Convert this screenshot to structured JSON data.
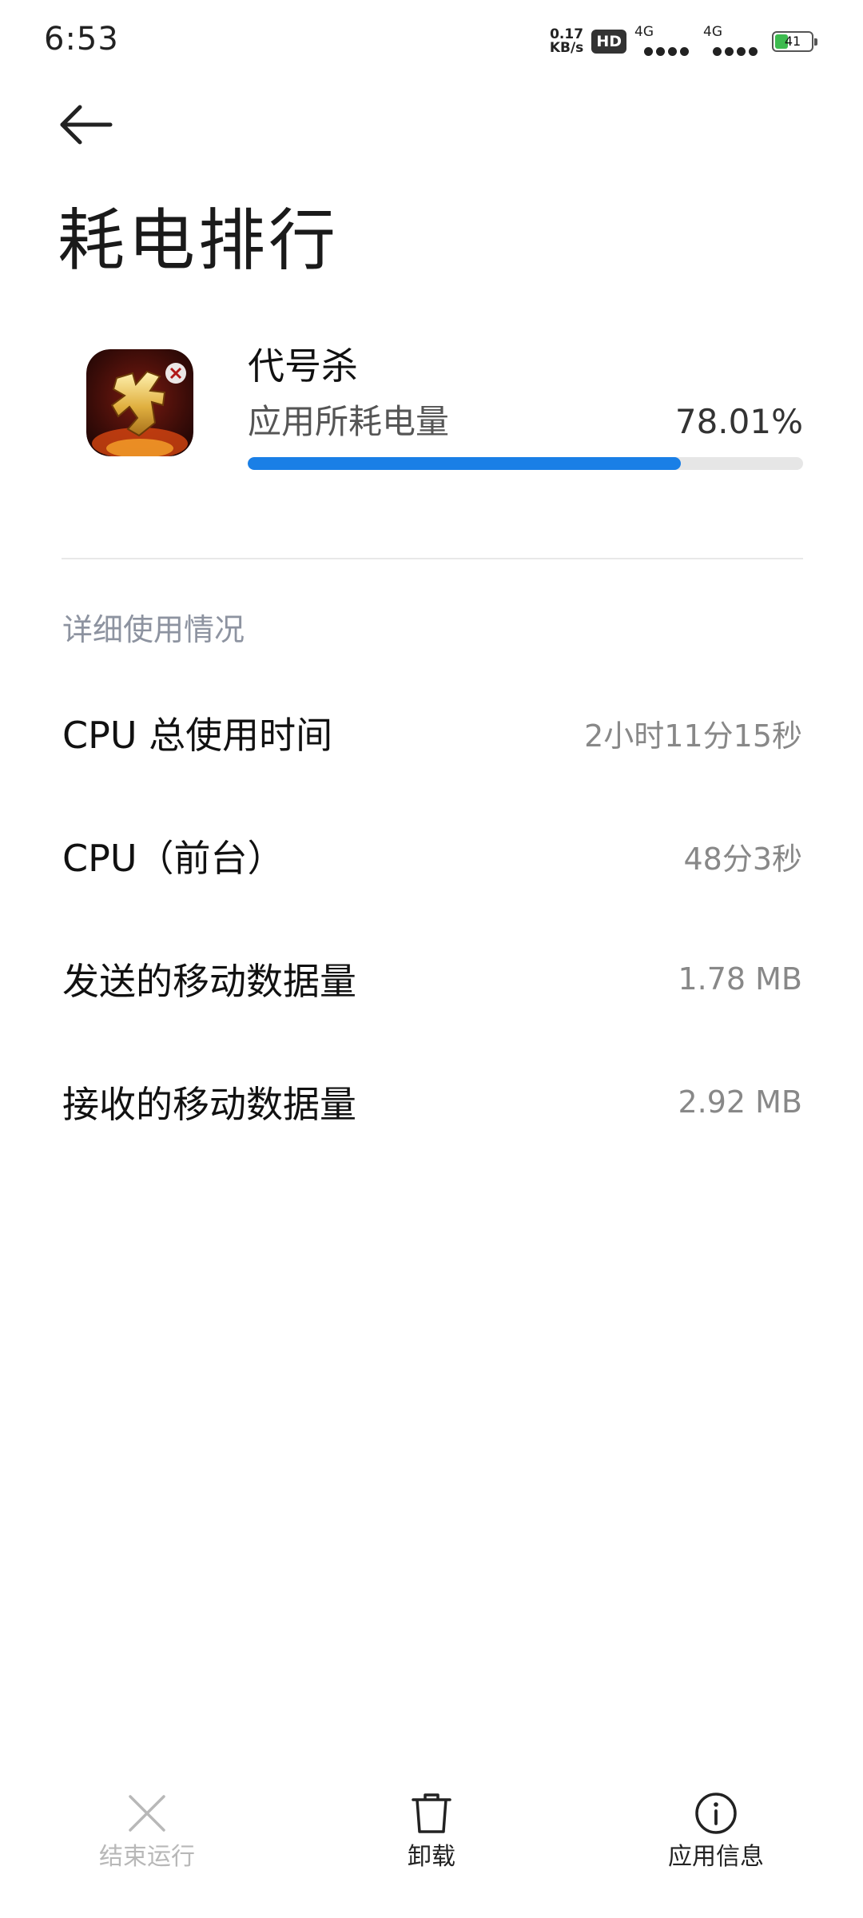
{
  "status_bar": {
    "time": "6:53",
    "net_speed_value": "0.17",
    "net_speed_unit": "KB/s",
    "hd_badge": "HD",
    "sim1_network": "4G",
    "sim2_network": "4G",
    "battery_level": "41"
  },
  "header": {
    "back_icon": "arrow-left-icon",
    "title": "耗电排行"
  },
  "app_usage": {
    "app_name": "代号杀",
    "app_icon": "app-icon-daihaosha",
    "usage_label": "应用所耗电量",
    "usage_percent_text": "78.01%",
    "usage_fraction": 0.7801
  },
  "details": {
    "section_title": "详细使用情况",
    "rows": [
      {
        "label": "CPU 总使用时间",
        "value": "2小时11分15秒"
      },
      {
        "label": "CPU（前台）",
        "value": "48分3秒"
      },
      {
        "label": "发送的移动数据量",
        "value": "1.78 MB"
      },
      {
        "label": "接收的移动数据量",
        "value": "2.92 MB"
      }
    ]
  },
  "bottom_actions": [
    {
      "label": "结束运行",
      "icon": "close-icon",
      "enabled": false
    },
    {
      "label": "卸载",
      "icon": "trash-icon",
      "enabled": true
    },
    {
      "label": "应用信息",
      "icon": "info-icon",
      "enabled": true
    }
  ],
  "colors": {
    "progress_fill": "#1a7fe6",
    "progress_track": "#e6e6e6",
    "battery_fill": "#3dbb4f",
    "section_header": "#8d93a0",
    "disabled": "#b8b8b8"
  }
}
